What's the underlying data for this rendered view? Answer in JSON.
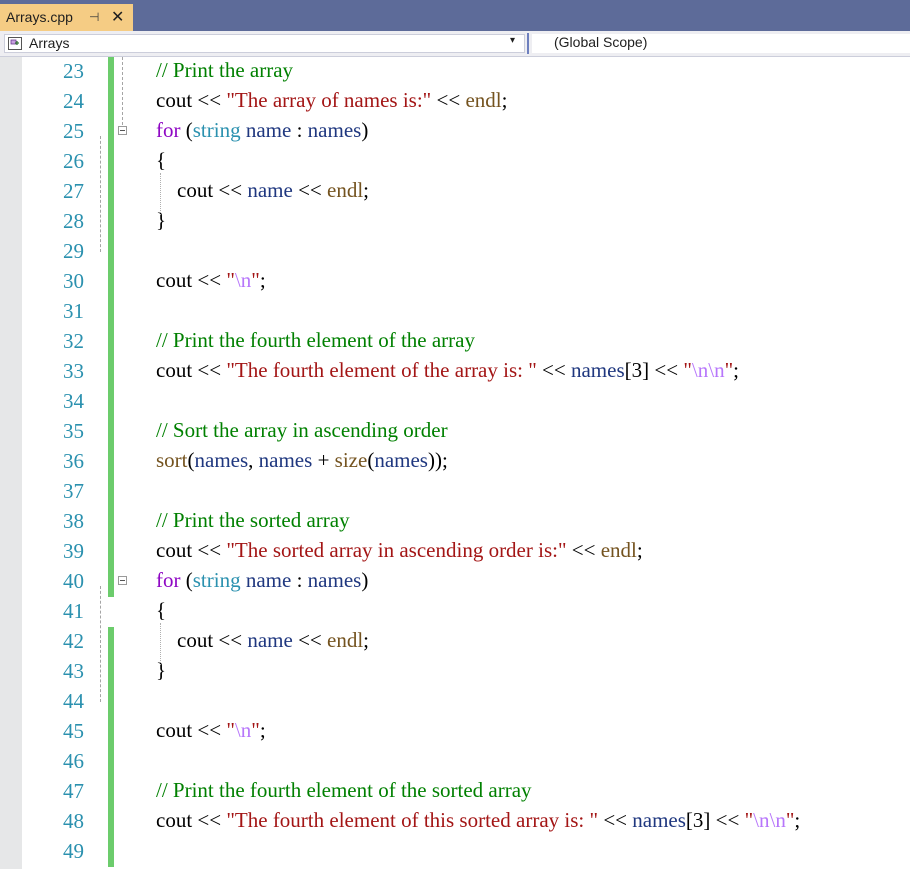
{
  "tab": {
    "title": "Arrays.cpp",
    "pin_icon": "⊣",
    "close_icon": "✕"
  },
  "navbar": {
    "left": "Arrays",
    "right": "(Global Scope)",
    "dropdown_icon": "▾"
  },
  "lines": [
    {
      "n": "23",
      "t": [
        [
          "cm",
          "// Print the array"
        ]
      ]
    },
    {
      "n": "24",
      "t": [
        [
          "pl",
          "cout "
        ],
        [
          "pl",
          "<< "
        ],
        [
          "st",
          "\"The array of names is:\""
        ],
        [
          "pl",
          " << "
        ],
        [
          "fn",
          "endl"
        ],
        [
          "pl",
          ";"
        ]
      ]
    },
    {
      "n": "25",
      "t": [
        [
          "kw",
          "for"
        ],
        [
          "pl",
          " ("
        ],
        [
          "tp",
          "string"
        ],
        [
          "pl",
          " "
        ],
        [
          "vr",
          "name"
        ],
        [
          "pl",
          " : "
        ],
        [
          "vr",
          "names"
        ],
        [
          "pl",
          ")"
        ]
      ]
    },
    {
      "n": "26",
      "t": [
        [
          "pl",
          "{"
        ]
      ]
    },
    {
      "n": "27",
      "t": [
        [
          "pl",
          "    cout "
        ],
        [
          "pl",
          "<< "
        ],
        [
          "vr",
          "name"
        ],
        [
          "pl",
          " << "
        ],
        [
          "fn",
          "endl"
        ],
        [
          "pl",
          ";"
        ]
      ]
    },
    {
      "n": "28",
      "t": [
        [
          "pl",
          "}"
        ]
      ]
    },
    {
      "n": "29",
      "t": []
    },
    {
      "n": "30",
      "t": [
        [
          "pl",
          "cout "
        ],
        [
          "pl",
          "<< "
        ],
        [
          "st",
          "\""
        ],
        [
          "es",
          "\\n"
        ],
        [
          "st",
          "\""
        ],
        [
          "pl",
          ";"
        ]
      ]
    },
    {
      "n": "31",
      "t": []
    },
    {
      "n": "32",
      "t": [
        [
          "cm",
          "// Print the fourth element of the array"
        ]
      ]
    },
    {
      "n": "33",
      "t": [
        [
          "pl",
          "cout "
        ],
        [
          "pl",
          "<< "
        ],
        [
          "st",
          "\"The fourth element of the array is: \""
        ],
        [
          "pl",
          " << "
        ],
        [
          "vr",
          "names"
        ],
        [
          "pl",
          "[3] << "
        ],
        [
          "st",
          "\""
        ],
        [
          "es",
          "\\n\\n"
        ],
        [
          "st",
          "\""
        ],
        [
          "pl",
          ";"
        ]
      ]
    },
    {
      "n": "34",
      "t": []
    },
    {
      "n": "35",
      "t": [
        [
          "cm",
          "// Sort the array in ascending order"
        ]
      ]
    },
    {
      "n": "36",
      "t": [
        [
          "fn",
          "sort"
        ],
        [
          "pl",
          "("
        ],
        [
          "vr",
          "names"
        ],
        [
          "pl",
          ", "
        ],
        [
          "vr",
          "names"
        ],
        [
          "pl",
          " + "
        ],
        [
          "fn",
          "size"
        ],
        [
          "pl",
          "("
        ],
        [
          "vr",
          "names"
        ],
        [
          "pl",
          "));"
        ]
      ]
    },
    {
      "n": "37",
      "t": []
    },
    {
      "n": "38",
      "t": [
        [
          "cm",
          "// Print the sorted array"
        ]
      ]
    },
    {
      "n": "39",
      "t": [
        [
          "pl",
          "cout "
        ],
        [
          "pl",
          "<< "
        ],
        [
          "st",
          "\"The sorted array in ascending order is:\""
        ],
        [
          "pl",
          " << "
        ],
        [
          "fn",
          "endl"
        ],
        [
          "pl",
          ";"
        ]
      ]
    },
    {
      "n": "40",
      "t": [
        [
          "kw",
          "for"
        ],
        [
          "pl",
          " ("
        ],
        [
          "tp",
          "string"
        ],
        [
          "pl",
          " "
        ],
        [
          "vr",
          "name"
        ],
        [
          "pl",
          " : "
        ],
        [
          "vr",
          "names"
        ],
        [
          "pl",
          ")"
        ]
      ]
    },
    {
      "n": "41",
      "t": [
        [
          "pl",
          "{"
        ]
      ]
    },
    {
      "n": "42",
      "t": [
        [
          "pl",
          "    cout "
        ],
        [
          "pl",
          "<< "
        ],
        [
          "vr",
          "name"
        ],
        [
          "pl",
          " << "
        ],
        [
          "fn",
          "endl"
        ],
        [
          "pl",
          ";"
        ]
      ]
    },
    {
      "n": "43",
      "t": [
        [
          "pl",
          "}"
        ]
      ]
    },
    {
      "n": "44",
      "t": []
    },
    {
      "n": "45",
      "t": [
        [
          "pl",
          "cout "
        ],
        [
          "pl",
          "<< "
        ],
        [
          "st",
          "\""
        ],
        [
          "es",
          "\\n"
        ],
        [
          "st",
          "\""
        ],
        [
          "pl",
          ";"
        ]
      ]
    },
    {
      "n": "46",
      "t": []
    },
    {
      "n": "47",
      "t": [
        [
          "cm",
          "// Print the fourth element of the sorted array"
        ]
      ]
    },
    {
      "n": "48",
      "t": [
        [
          "pl",
          "cout "
        ],
        [
          "pl",
          "<< "
        ],
        [
          "st",
          "\"The fourth element of this sorted array is: \""
        ],
        [
          "pl",
          " << "
        ],
        [
          "vr",
          "names"
        ],
        [
          "pl",
          "[3] << "
        ],
        [
          "st",
          "\""
        ],
        [
          "es",
          "\\n\\n"
        ],
        [
          "st",
          "\""
        ],
        [
          "pl",
          ";"
        ]
      ]
    },
    {
      "n": "49",
      "t": []
    }
  ],
  "changed_lines": [
    "23",
    "24",
    "25",
    "26",
    "27",
    "28",
    "29",
    "30",
    "31",
    "32",
    "33",
    "34",
    "35",
    "36",
    "37",
    "38",
    "39",
    "40",
    "42",
    "43",
    "44",
    "45",
    "46",
    "47",
    "48",
    "49"
  ],
  "folds": [
    "25",
    "40"
  ],
  "colors": {
    "comment": "#008000",
    "string": "#a31515",
    "keyword": "#8f08c4",
    "type": "#2b91af",
    "variable": "#1f377f",
    "function": "#74531f",
    "escape": "#b776fb",
    "line_number": "#2b91af",
    "change_bar": "#6ccc6c",
    "tab_active": "#f5cc84",
    "titlebar": "#5d6b99"
  }
}
